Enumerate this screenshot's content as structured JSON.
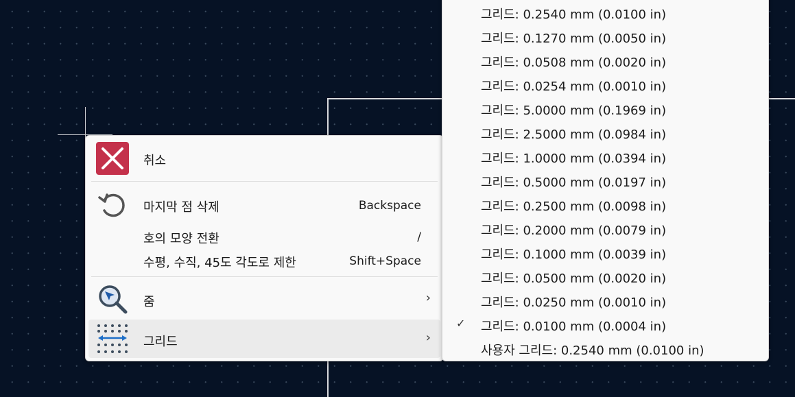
{
  "main_menu": {
    "undo_label": "취소",
    "delete_last_point_label": "마지막 점 삭제",
    "delete_last_point_shortcut": "Backspace",
    "toggle_arc_label": "호의 모양 전환",
    "toggle_arc_shortcut": "/",
    "constrain_label": "수평, 수직, 45도 각도로 제한",
    "constrain_shortcut": "Shift+Space",
    "zoom_label": "줌",
    "grid_label": "그리드",
    "submenu_arrow": "›"
  },
  "grid_submenu": {
    "checked_mark": "✓",
    "selected_index": 13,
    "items": [
      "그리드: 0.2540 mm (0.0100 in)",
      "그리드: 0.1270 mm (0.0050 in)",
      "그리드: 0.0508 mm (0.0020 in)",
      "그리드: 0.0254 mm (0.0010 in)",
      "그리드: 5.0000 mm (0.1969 in)",
      "그리드: 2.5000 mm (0.0984 in)",
      "그리드: 1.0000 mm (0.0394 in)",
      "그리드: 0.5000 mm (0.0197 in)",
      "그리드: 0.2500 mm (0.0098 in)",
      "그리드: 0.2000 mm (0.0079 in)",
      "그리드: 0.1000 mm (0.0039 in)",
      "그리드: 0.0500 mm (0.0020 in)",
      "그리드: 0.0250 mm (0.0010 in)",
      "그리드: 0.0100 mm (0.0004 in)",
      "사용자 그리드: 0.2540 mm (0.0100 in)"
    ]
  },
  "colors": {
    "canvas_background": "#061225",
    "menu_background": "#f9f9f9",
    "highlight": "#ebebeb",
    "cancel_red": "#c4314b"
  },
  "icons": {
    "undo": "cancel-x-icon",
    "delete_last_point": "undo-arrow-icon",
    "zoom": "zoom-magnifier-icon",
    "grid": "grid-dots-icon"
  }
}
